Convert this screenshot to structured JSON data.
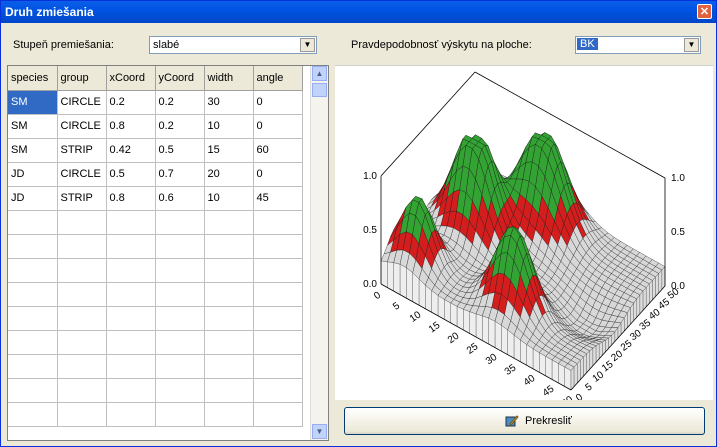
{
  "window": {
    "title": "Druh zmiešania"
  },
  "left": {
    "mix_label": "Stupeň premiešania:",
    "mix_value": "slabé",
    "table": {
      "columns": [
        "species",
        "group",
        "xCoord",
        "yCoord",
        "width",
        "angle"
      ],
      "rows": [
        [
          "SM",
          "CIRCLE",
          "0.2",
          "0.2",
          "30",
          "0"
        ],
        [
          "SM",
          "CIRCLE",
          "0.8",
          "0.2",
          "10",
          "0"
        ],
        [
          "SM",
          "STRIP",
          "0.42",
          "0.5",
          "15",
          "60"
        ],
        [
          "JD",
          "CIRCLE",
          "0.5",
          "0.7",
          "20",
          "0"
        ],
        [
          "JD",
          "STRIP",
          "0.8",
          "0.6",
          "10",
          "45"
        ]
      ]
    }
  },
  "right": {
    "prob_label": "Pravdepodobnosť výskytu  na ploche:",
    "prob_value": "BK",
    "redraw_button": "Prekresliť",
    "plot": {
      "z_ticks_left": [
        "1.0",
        "0.5",
        "0.0"
      ],
      "z_ticks_right": [
        "1.0",
        "0.5",
        "0.0"
      ],
      "x_ticks": [
        "0",
        "5",
        "10",
        "15",
        "20",
        "25",
        "30",
        "35",
        "40",
        "45",
        "50"
      ],
      "y_ticks": [
        "0",
        "5",
        "10",
        "15",
        "20",
        "25",
        "30",
        "35",
        "40",
        "45",
        "50"
      ],
      "colors": {
        "high": "#33a333",
        "mid": "#d41d1d",
        "low": "#d8d8d8"
      }
    }
  }
}
